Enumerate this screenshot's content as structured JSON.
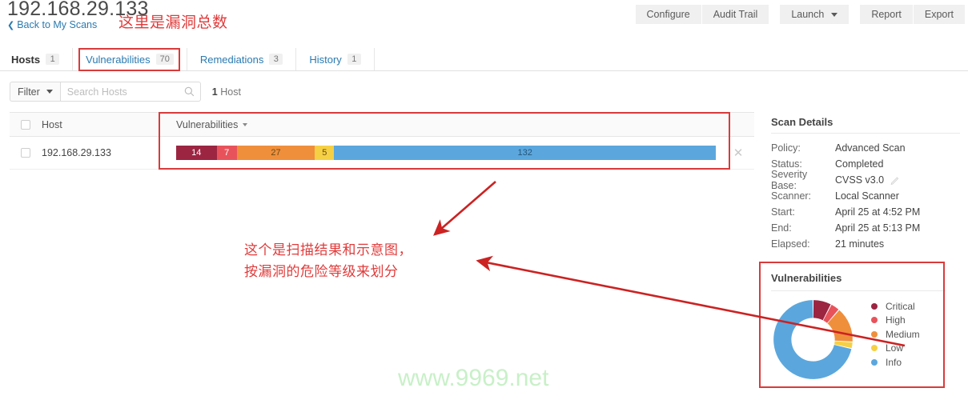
{
  "header": {
    "scan_title": "192.168.29.133",
    "back_link": "Back to My Scans",
    "buttons": [
      {
        "label": "Configure",
        "caret": false
      },
      {
        "label": "Audit Trail",
        "caret": false
      },
      {
        "label": "Launch",
        "caret": true
      },
      {
        "label": "Report",
        "caret": false
      },
      {
        "label": "Export",
        "caret": false
      }
    ]
  },
  "tabs": [
    {
      "label": "Hosts",
      "badge": "1",
      "active": true
    },
    {
      "label": "Vulnerabilities",
      "badge": "70",
      "active": false
    },
    {
      "label": "Remediations",
      "badge": "3",
      "active": false
    },
    {
      "label": "History",
      "badge": "1",
      "active": false
    }
  ],
  "filterbar": {
    "filter_label": "Filter",
    "search_placeholder": "Search Hosts",
    "search_value": "",
    "count_number": "1",
    "count_label": "Host"
  },
  "table": {
    "columns": {
      "host": "Host",
      "vulnerabilities": "Vulnerabilities"
    },
    "rows": [
      {
        "host": "192.168.29.133",
        "segments": [
          {
            "label": "14",
            "severity": "Critical",
            "value": 14,
            "color": "#9c2542",
            "text_color": "#ffffff"
          },
          {
            "label": "7",
            "severity": "High",
            "value": 7,
            "color": "#e8535b",
            "text_color": "#ffffff"
          },
          {
            "label": "27",
            "severity": "Medium",
            "value": 27,
            "color": "#ef8f3c",
            "text_color": "#6b4a14"
          },
          {
            "label": "5",
            "severity": "Low",
            "value": 5,
            "color": "#f6d044",
            "text_color": "#6b4a14"
          },
          {
            "label": "132",
            "severity": "Info",
            "value": 132,
            "color": "#5ba7dd",
            "text_color": "#24557a"
          }
        ]
      }
    ]
  },
  "scan_details": {
    "title": "Scan Details",
    "rows": [
      {
        "label": "Policy:",
        "value": "Advanced Scan"
      },
      {
        "label": "Status:",
        "value": "Completed"
      },
      {
        "label": "Severity Base:",
        "value": "CVSS v3.0",
        "editable": true
      },
      {
        "label": "Scanner:",
        "value": "Local Scanner"
      },
      {
        "label": "Start:",
        "value": "April 25 at 4:52 PM"
      },
      {
        "label": "End:",
        "value": "April 25 at 5:13 PM"
      },
      {
        "label": "Elapsed:",
        "value": "21 minutes"
      }
    ]
  },
  "vulnerabilities_card": {
    "title": "Vulnerabilities",
    "legend": [
      {
        "label": "Critical",
        "color": "#9c2542"
      },
      {
        "label": "High",
        "color": "#e8535b"
      },
      {
        "label": "Medium",
        "color": "#ef8f3c"
      },
      {
        "label": "Low",
        "color": "#f6d044"
      },
      {
        "label": "Info",
        "color": "#5ba7dd"
      }
    ]
  },
  "chart_data": {
    "type": "pie",
    "title": "Vulnerabilities",
    "categories": [
      "Critical",
      "High",
      "Medium",
      "Low",
      "Info"
    ],
    "values": [
      14,
      7,
      27,
      5,
      132
    ],
    "colors": [
      "#9c2542",
      "#e8535b",
      "#ef8f3c",
      "#f6d044",
      "#5ba7dd"
    ],
    "total": 185,
    "donut": true,
    "inner_radius_ratio": 0.55,
    "start_angle_deg": 0,
    "direction": "clockwise",
    "legend_position": "right"
  },
  "annotations": {
    "title_note": "这里是漏洞总数",
    "body_note": "这个是扫描结果和示意图，\n按漏洞的危险等级来划分",
    "box_color": "#d93b3b",
    "arrow_color": "#cc2222"
  },
  "watermark": {
    "text": "www.9969.net",
    "color": "#c8f0c8"
  }
}
